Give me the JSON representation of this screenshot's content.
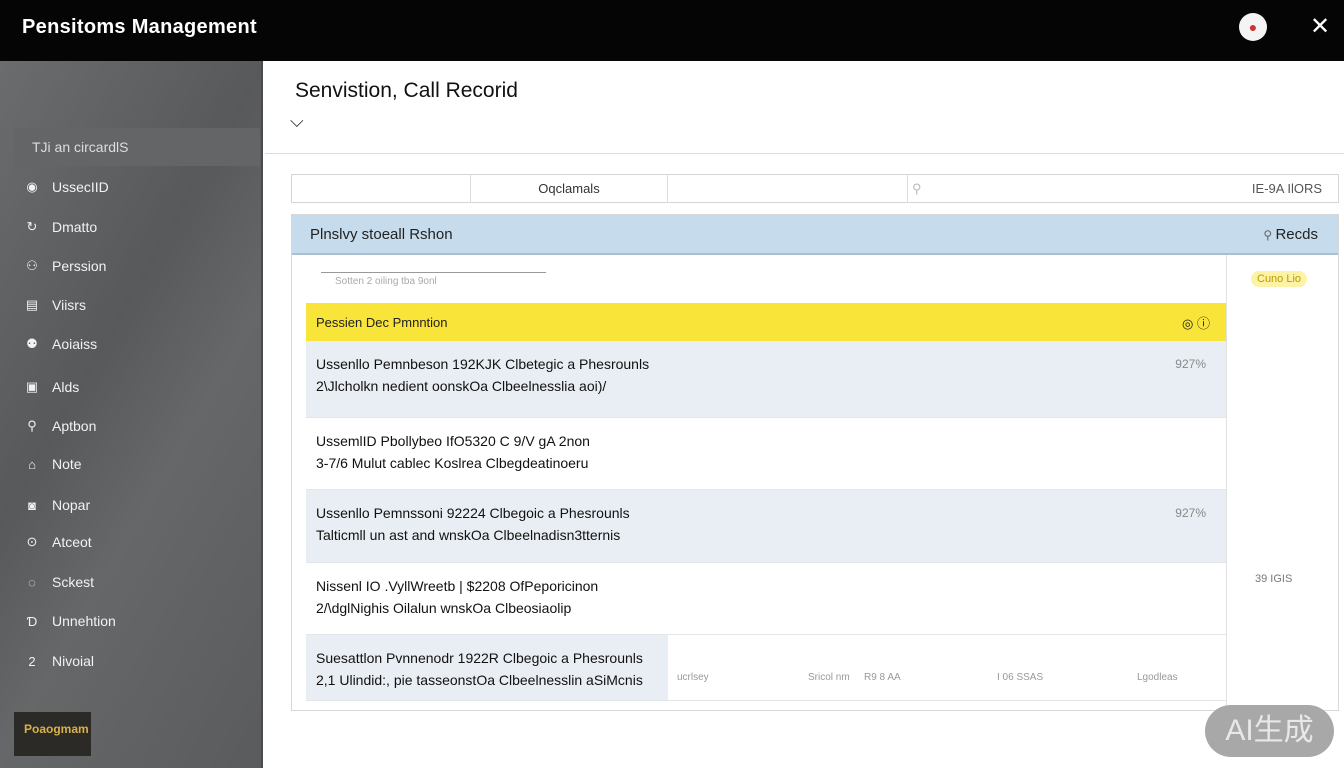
{
  "app": {
    "title": "Pensitoms Management",
    "close": "✕"
  },
  "sidebar": {
    "header": "TJi an circardlS",
    "items": [
      {
        "label": "UssecIID",
        "icon": "◉"
      },
      {
        "label": "Dmatto",
        "icon": "↻"
      },
      {
        "label": "Perssion",
        "icon": "⚇"
      },
      {
        "label": "Viisrs",
        "icon": "▤"
      },
      {
        "label": "Aoiaiss",
        "icon": "⚉"
      },
      {
        "label": "Alds",
        "icon": "▣"
      },
      {
        "label": "Aptbon",
        "icon": "⚲"
      },
      {
        "label": "Note",
        "icon": "⌂"
      },
      {
        "label": "Nopar",
        "icon": "◙"
      },
      {
        "label": "Atceot",
        "icon": "⊙"
      },
      {
        "label": "Sckest",
        "icon": "◌"
      },
      {
        "label": "Unnehtion",
        "icon": "Ɗ"
      },
      {
        "label": "Nivoial",
        "icon": "2"
      }
    ],
    "logo": "Poaogmam"
  },
  "main": {
    "title": "Senvistion, Call Recorid",
    "filter": {
      "column": "Oqclamals",
      "search_placeholder": "",
      "right": "IE-9A IlORS"
    },
    "panel": {
      "title": "Plnslvy stoeall Rshon",
      "action": "Recds",
      "mini_input": "Sotten 2 oiling tba 9onl",
      "highlight": "Pessien Dec Pmnntion",
      "rows": [
        {
          "line1": "Ussenllo Pemnbeson 192KJK Clbetegic a Phesrounls",
          "line2": "2\\Jlcholkn nedient oonskOa Clbeelnesslia aoi)/",
          "value": "927%"
        },
        {
          "line1": "UssemlID Pbollybeo IfO5320 C 9/V gA 2non",
          "line2": "3-7/6 Mulut cablec Koslrea Clbegdeatinoeru",
          "value": ""
        },
        {
          "line1": "Ussenllo Pemnssoni 92224 Clbegoic a Phesrounls",
          "line2": "Talticmll un ast and wnskOa Clbeelnadisn3tternis",
          "value": "927%"
        },
        {
          "line1": "Nissenl IO .VyllWreetb | $2208 OfPeporicinon",
          "line2": "2/\\dglNighis Oilalun wnskOa Clbeosiaolip",
          "value": ""
        },
        {
          "line1": "Suesattlon Pvnnenodr 1922R Clbegoic a Phesrounls",
          "line2": "2,1 Ulindid:, pie tasseonstOa Clbeelnesslin aSiMcnis",
          "value": ""
        }
      ],
      "footer": [
        "ucrlsey",
        "Sricol nm",
        "R9 8 AA",
        "I 06 SSAS",
        "Lgodleas"
      ],
      "side_badge": "Cuno Lio",
      "side_value": "39 IGIS"
    }
  },
  "watermark": "AI生成"
}
